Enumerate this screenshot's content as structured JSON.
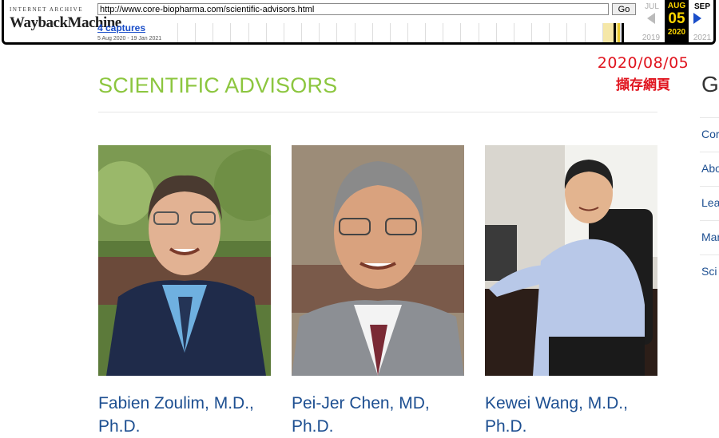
{
  "wayback": {
    "logo_top": "INTERNET ARCHIVE",
    "logo_wayback": "WaybackMachine",
    "url": "http://www.core-biopharma.com/scientific-advisors.html",
    "go_label": "Go",
    "captures_label": "4 captures",
    "capture_range": "5 Aug 2020 - 19 Jan 2021",
    "prev_month": "JUL",
    "current_month": "AUG",
    "current_day": "05",
    "current_year": "2020",
    "next_month": "SEP",
    "prev_year": "2019",
    "next_year": "2021",
    "accent_color": "#ffd700"
  },
  "annotation": {
    "date": "2020/08/05",
    "caption": "擷存網頁"
  },
  "page": {
    "title": "SCIENTIFIC ADVISORS",
    "title_color": "#8cc63f"
  },
  "advisors": [
    {
      "name": "Fabien Zoulim, M.D., Ph.D."
    },
    {
      "name": "Pei-Jer Chen, MD, Ph.D."
    },
    {
      "name": "Kewei Wang, M.D., Ph.D."
    }
  ],
  "nav": {
    "heading": "G",
    "items": [
      "Cor",
      "Abo",
      "Lea",
      "Mar",
      "Sci"
    ]
  }
}
